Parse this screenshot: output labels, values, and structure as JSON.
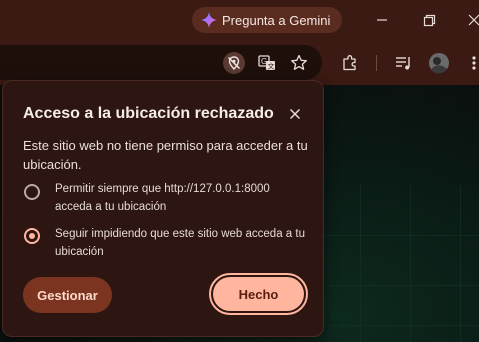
{
  "titlebar": {
    "gemini_label": "Pregunta a Gemini",
    "icons": [
      "gemini-sparkle-icon",
      "minimize-icon",
      "restore-icon",
      "close-icon"
    ]
  },
  "toolbar": {
    "icons": [
      "location-blocked-icon",
      "translate-icon",
      "bookmark-star-icon",
      "extensions-icon",
      "media-queue-icon",
      "profile-avatar",
      "more-menu-icon"
    ]
  },
  "popup": {
    "title": "Acceso a la ubicación rechazado",
    "description": "Este sitio web no tiene permiso para acceder a tu ubicación.",
    "options": [
      {
        "label": "Permitir siempre que http://127.0.0.1:8000 acceda a tu ubicación",
        "selected": false
      },
      {
        "label": "Seguir impidiendo que este sitio web acceda a tu ubicación",
        "selected": true
      }
    ],
    "manage_label": "Gestionar",
    "done_label": "Hecho"
  },
  "colors": {
    "chrome_frame": "#3a1a12",
    "popup_bg": "#2d1611",
    "accent": "#ffb59e",
    "secondary_button": "#7a3420"
  }
}
